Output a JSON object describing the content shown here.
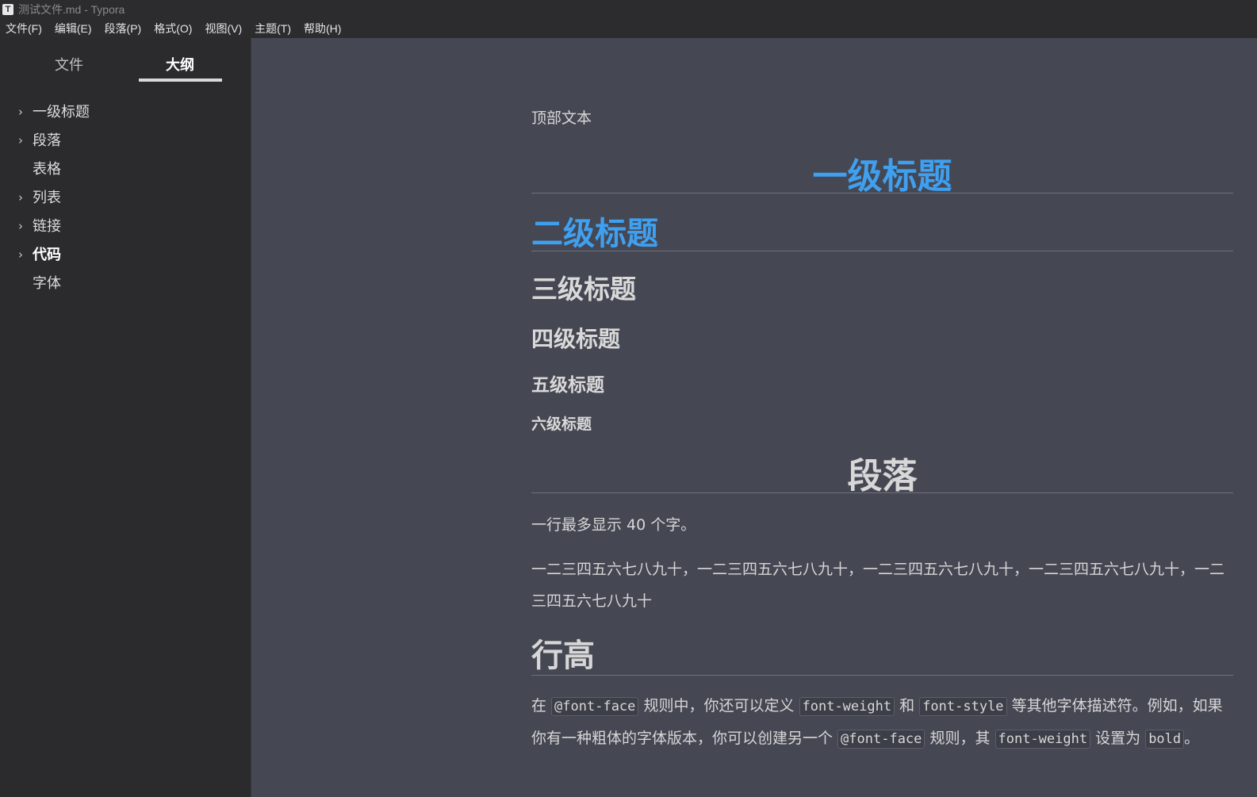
{
  "window": {
    "title": "测试文件.md - Typora",
    "app_icon_glyph": "T"
  },
  "menubar": {
    "items": [
      "文件(F)",
      "编辑(E)",
      "段落(P)",
      "格式(O)",
      "视图(V)",
      "主题(T)",
      "帮助(H)"
    ]
  },
  "sidebar": {
    "tabs": {
      "files": "文件",
      "outline": "大纲"
    },
    "outline": [
      {
        "label": "一级标题",
        "has_children": true
      },
      {
        "label": "段落",
        "has_children": true
      },
      {
        "label": "表格",
        "has_children": false
      },
      {
        "label": "列表",
        "has_children": true
      },
      {
        "label": "链接",
        "has_children": true
      },
      {
        "label": "代码",
        "has_children": true,
        "active": true
      },
      {
        "label": "字体",
        "has_children": false
      }
    ]
  },
  "document": {
    "top_text": "顶部文本",
    "h1_title": "一级标题",
    "h2_title": "二级标题",
    "h3_title": "三级标题",
    "h4_title": "四级标题",
    "h5_title": "五级标题",
    "h6_title": "六级标题",
    "h1_paragraph": "段落",
    "para1": "一行最多显示 40 个字。",
    "para2": "一二三四五六七八九十，一二三四五六七八九十，一二三四五六七八九十，一二三四五六七八九十，一二三四五六七八九十",
    "h2_lineheight": "行高",
    "para3": {
      "t1": "在 ",
      "c1": "@font-face",
      "t2": " 规则中，你还可以定义 ",
      "c2": "font-weight",
      "t3": " 和 ",
      "c3": "font-style",
      "t4": " 等其他字体描述符。例如，如果你有一种粗体的字体版本，你可以创建另一个 ",
      "c4": "@font-face",
      "t5": " 规则，其 ",
      "c5": "font-weight",
      "t6": " 设置为 ",
      "c6": "bold",
      "t7": "。"
    }
  },
  "colors": {
    "accent_heading": "#3fa0f0",
    "editor_bg": "#454753",
    "sidebar_bg": "#2b2b2e"
  }
}
